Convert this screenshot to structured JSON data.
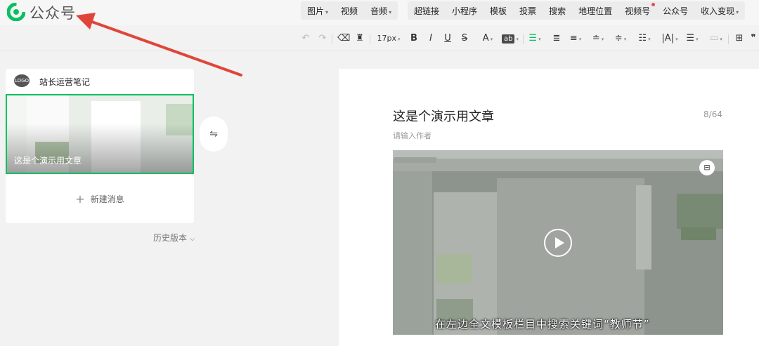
{
  "header": {
    "brand": "公众号",
    "menu_group_1": [
      {
        "label": "图片",
        "has_caret": true
      },
      {
        "label": "视频",
        "has_caret": false
      },
      {
        "label": "音频",
        "has_caret": true
      }
    ],
    "menu_group_2": [
      {
        "label": "超链接"
      },
      {
        "label": "小程序"
      },
      {
        "label": "模板"
      },
      {
        "label": "投票"
      },
      {
        "label": "搜索"
      },
      {
        "label": "地理位置"
      },
      {
        "label": "视频号"
      },
      {
        "label": "公众号"
      },
      {
        "label": "收入变现"
      }
    ]
  },
  "toolbar": {
    "font_size": "17px",
    "bold": "B",
    "italic": "I",
    "underline": "U",
    "strike": "S",
    "font_color": "A",
    "highlight": "ab"
  },
  "sidebar": {
    "account_name": "站长运营笔记",
    "avatar_text": "LOGO",
    "thumb_title": "这是个演示用文章",
    "new_message": "新建消息",
    "history": "历史版本"
  },
  "editor": {
    "title": "这是个演示用文章",
    "char_count": "8/64",
    "author_placeholder": "请输入作者",
    "video_subtitle": "在左边全文模板栏目中搜索关键词“教师节”"
  },
  "colors": {
    "accent": "#07c160",
    "arrow": "#e0453a",
    "notification_dot": "#e0534a"
  },
  "icons": {
    "swap": "swap-icon",
    "play": "play-icon",
    "undo": "undo-icon",
    "redo": "redo-icon"
  }
}
